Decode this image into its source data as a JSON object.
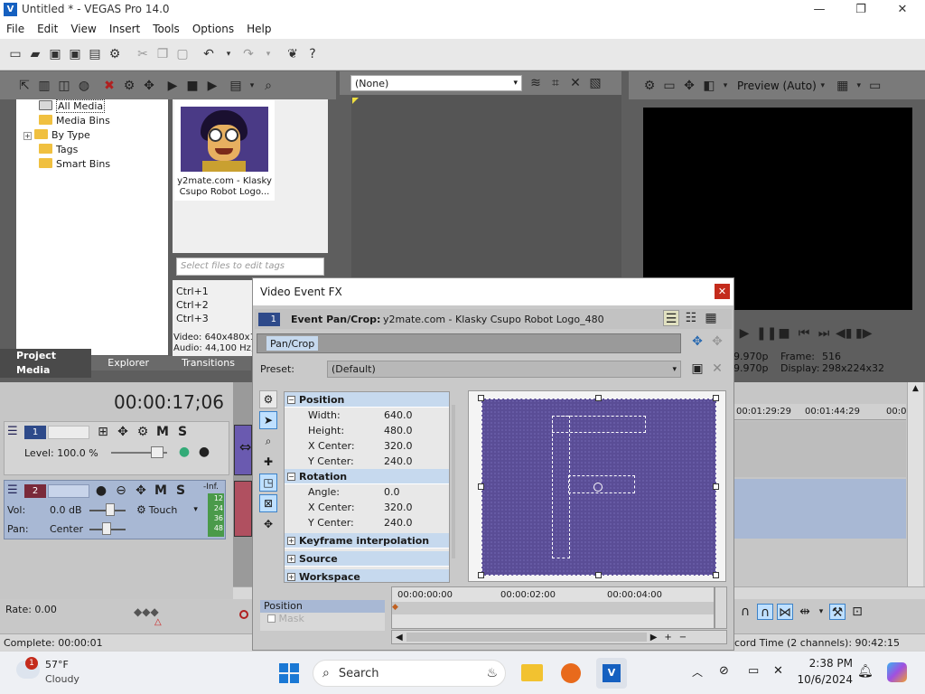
{
  "window": {
    "title": "Untitled * - VEGAS Pro 14.0",
    "app_icon": "vegas-logo-icon",
    "minimize": "—",
    "restore": "❐",
    "close": "✕"
  },
  "menu": [
    "File",
    "Edit",
    "View",
    "Insert",
    "Tools",
    "Options",
    "Help"
  ],
  "explorer": {
    "tree": [
      "All Media",
      "Media Bins",
      "By Type",
      "Tags",
      "Smart Bins"
    ],
    "media_item_label": "y2mate.com - Klasky Csupo Robot Logo...",
    "tags_placeholder": "Select files to edit tags",
    "shortcuts": [
      "Ctrl+1",
      "Ctrl+2",
      "Ctrl+3"
    ],
    "file_info": [
      "Video: 640x480x1",
      "Audio: 44,100 Hz,"
    ],
    "tabs": [
      "Project Media",
      "Explorer",
      "Transitions"
    ]
  },
  "trimmer": {
    "select_value": "(None)"
  },
  "preview": {
    "mode": "Preview (Auto)",
    "frame_label": "Frame:",
    "frame_value": "516",
    "display_label": "Display:",
    "display_value": "298x224x32",
    "fps1": "9.970p",
    "fps2": "9.970p"
  },
  "timeline": {
    "timecode": "00:00:17;06",
    "ruler": [
      "00:01:29:29",
      "00:01:44:29",
      "00:0"
    ],
    "tracks": [
      {
        "num": "1",
        "level_label": "Level: 100.0 %"
      },
      {
        "num": "2",
        "vol_label": "Vol:",
        "vol_value": "0.0 dB",
        "pan_label": "Pan:",
        "pan_value": "Center",
        "touch": "Touch",
        "inf": "-Inf.",
        "meter": [
          "12",
          "24",
          "36",
          "48"
        ]
      }
    ],
    "rate": "Rate: 0.00",
    "status": "Complete: 00:00:01",
    "record_time": "cord Time (2 channels): 90:42:15"
  },
  "fx": {
    "title": "Video Event FX",
    "badge": "1",
    "header_label": "Event Pan/Crop:",
    "header_value": "y2mate.com - Klasky Csupo Robot Logo_480",
    "chain_item": "Pan/Crop",
    "preset_label": "Preset:",
    "preset_value": "(Default)",
    "sections": {
      "position": {
        "label": "Position",
        "rows": [
          {
            "name": "Width:",
            "value": "640.0"
          },
          {
            "name": "Height:",
            "value": "480.0"
          },
          {
            "name": "X Center:",
            "value": "320.0"
          },
          {
            "name": "Y Center:",
            "value": "240.0"
          }
        ]
      },
      "rotation": {
        "label": "Rotation",
        "rows": [
          {
            "name": "Angle:",
            "value": "0.0"
          },
          {
            "name": "X Center:",
            "value": "320.0"
          },
          {
            "name": "Y Center:",
            "value": "240.0"
          }
        ]
      },
      "keyframe": "Keyframe interpolation",
      "source": "Source",
      "workspace": "Workspace"
    },
    "kf_times": [
      "00:00:00:00",
      "00:00:02:00",
      "00:00:04:00"
    ],
    "kf_tracks": [
      "Position",
      "Mask"
    ]
  },
  "taskbar": {
    "weather_temp": "57°F",
    "weather_desc": "Cloudy",
    "weather_badge": "1",
    "search": "Search",
    "time": "2:38 PM",
    "date": "10/6/2024"
  },
  "colors": {
    "accent": "#1560c0",
    "fx_section": "#c6d9ee",
    "canvas": "#5a4d96",
    "close": "#c42b1c"
  }
}
